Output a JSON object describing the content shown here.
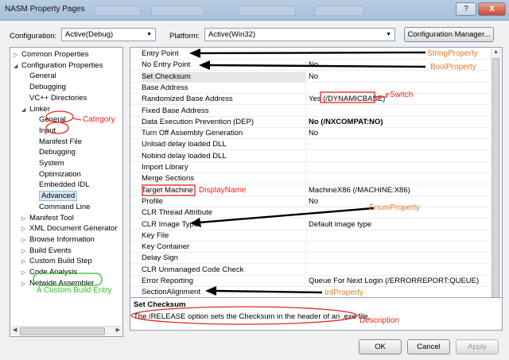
{
  "window": {
    "title": "NASM Property Pages",
    "help_glyph": "?",
    "close_glyph": "X"
  },
  "toolbar": {
    "configuration_label": "Configuration:",
    "configuration_value": "Active(Debug)",
    "platform_label": "Platform:",
    "platform_value": "Active(Win32)",
    "config_manager_label": "Configuration Manager..."
  },
  "tree": {
    "items": [
      {
        "label": "Common Properties",
        "level": 0,
        "twisty": "collapsed"
      },
      {
        "label": "Configuration Properties",
        "level": 0,
        "twisty": "expanded"
      },
      {
        "label": "General",
        "level": 1,
        "twisty": ""
      },
      {
        "label": "Debugging",
        "level": 1,
        "twisty": ""
      },
      {
        "label": "VC++ Directories",
        "level": 1,
        "twisty": ""
      },
      {
        "label": "Linker",
        "level": 1,
        "twisty": "expanded"
      },
      {
        "label": "General",
        "level": 2,
        "twisty": ""
      },
      {
        "label": "Input",
        "level": 2,
        "twisty": ""
      },
      {
        "label": "Manifest File",
        "level": 2,
        "twisty": ""
      },
      {
        "label": "Debugging",
        "level": 2,
        "twisty": ""
      },
      {
        "label": "System",
        "level": 2,
        "twisty": ""
      },
      {
        "label": "Optimization",
        "level": 2,
        "twisty": ""
      },
      {
        "label": "Embedded IDL",
        "level": 2,
        "twisty": ""
      },
      {
        "label": "Advanced",
        "level": 2,
        "twisty": "",
        "selected": true
      },
      {
        "label": "Command Line",
        "level": 2,
        "twisty": ""
      },
      {
        "label": "Manifest Tool",
        "level": 1,
        "twisty": "collapsed"
      },
      {
        "label": "XML Document Generator",
        "level": 1,
        "twisty": "collapsed"
      },
      {
        "label": "Browse Information",
        "level": 1,
        "twisty": "collapsed"
      },
      {
        "label": "Build Events",
        "level": 1,
        "twisty": "collapsed"
      },
      {
        "label": "Custom Build Step",
        "level": 1,
        "twisty": "collapsed"
      },
      {
        "label": "Code Analysis",
        "level": 1,
        "twisty": "collapsed"
      },
      {
        "label": "Netwide Assembler",
        "level": 1,
        "twisty": "collapsed"
      }
    ]
  },
  "grid": {
    "rows": [
      {
        "name": "Entry Point",
        "value": ""
      },
      {
        "name": "No Entry Point",
        "value": "No"
      },
      {
        "name": "Set Checksum",
        "value": "No",
        "selected": true
      },
      {
        "name": "Base Address",
        "value": ""
      },
      {
        "name": "Randomized Base Address",
        "value": "Yes (/DYNAMICBASE)"
      },
      {
        "name": "Fixed Base Address",
        "value": ""
      },
      {
        "name": "Data Execution Prevention (DEP)",
        "value": "No (/NXCOMPAT:NO)",
        "bold": true
      },
      {
        "name": "Turn Off Assembly Generation",
        "value": "No"
      },
      {
        "name": "Unload delay loaded DLL",
        "value": ""
      },
      {
        "name": "Nobind delay loaded DLL",
        "value": ""
      },
      {
        "name": "Import Library",
        "value": ""
      },
      {
        "name": "Merge Sections",
        "value": ""
      },
      {
        "name": "Target Machine",
        "value": "MachineX86 (/MACHINE:X86)"
      },
      {
        "name": "Profile",
        "value": "No"
      },
      {
        "name": "CLR Thread Attribute",
        "value": ""
      },
      {
        "name": "CLR Image Type",
        "value": "Default image type"
      },
      {
        "name": "Key File",
        "value": ""
      },
      {
        "name": "Key Container",
        "value": ""
      },
      {
        "name": "Delay Sign",
        "value": ""
      },
      {
        "name": "CLR Unmanaged Code Check",
        "value": ""
      },
      {
        "name": "Error Reporting",
        "value": "Queue For Next Login (/ERRORREPORT:QUEUE)"
      },
      {
        "name": "SectionAlignment",
        "value": ""
      }
    ]
  },
  "description": {
    "title": "Set Checksum",
    "text": "The /RELEASE option sets the Checksum in the header of an .exe file."
  },
  "buttons": {
    "ok": "OK",
    "cancel": "Cancel",
    "apply": "Apply"
  },
  "annotations": {
    "string_property": "StringProperty",
    "bool_property": "BoolProperty",
    "switch": "Switch",
    "category": "Category",
    "display_name": "DisplayName",
    "enum_property": "EnumProperty",
    "int_property": "IntProperty",
    "description": "Description",
    "custom_build_entry": "A Custom Build Entry"
  },
  "colors": {
    "annotation_red": "#e8241c",
    "annotation_orange": "#e07a2a",
    "annotation_green": "#2ebd2e"
  }
}
